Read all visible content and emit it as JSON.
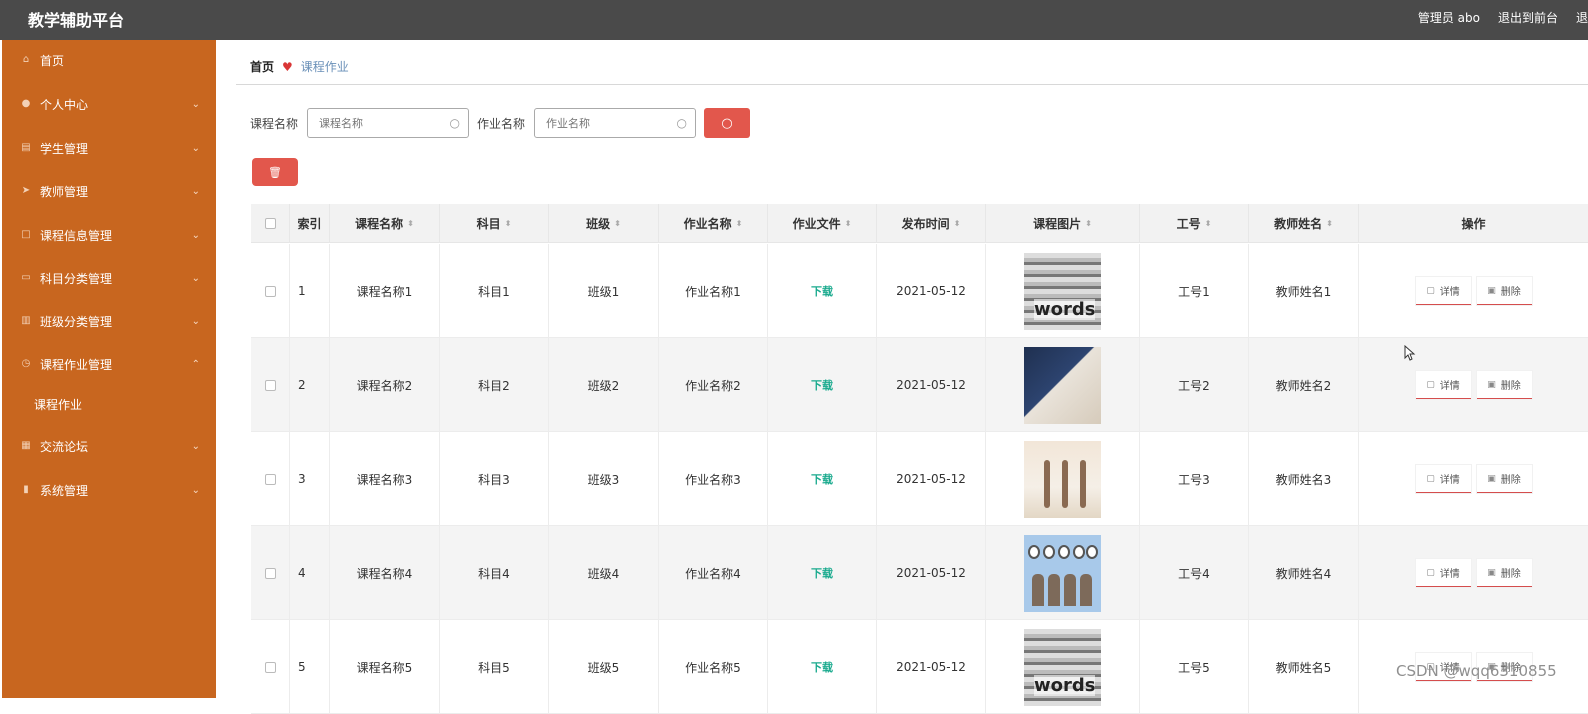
{
  "app": {
    "title": "教学辅助平台"
  },
  "topbar": {
    "user": "管理员 abo",
    "front_link": "退出到前台",
    "logout": "退"
  },
  "sidebar": {
    "items": [
      {
        "label": "首页",
        "icon": "home-icon"
      },
      {
        "label": "个人中心",
        "icon": "user-icon"
      },
      {
        "label": "学生管理",
        "icon": "list-icon"
      },
      {
        "label": "教师管理",
        "icon": "send-icon"
      },
      {
        "label": "课程信息管理",
        "icon": "square-icon"
      },
      {
        "label": "科目分类管理",
        "icon": "chat-icon"
      },
      {
        "label": "班级分类管理",
        "icon": "bar-chart-icon"
      },
      {
        "label": "课程作业管理",
        "icon": "clock-icon"
      },
      {
        "label": "交流论坛",
        "icon": "grid-icon"
      },
      {
        "label": "系统管理",
        "icon": "book-icon"
      }
    ],
    "sub_item": "课程作业"
  },
  "breadcrumb": {
    "home": "首页",
    "current": "课程作业"
  },
  "search": {
    "course_label": "课程名称",
    "course_placeholder": "课程名称",
    "homework_label": "作业名称",
    "homework_placeholder": "作业名称"
  },
  "table": {
    "headers": [
      "索引",
      "课程名称",
      "科目",
      "班级",
      "作业名称",
      "作业文件",
      "发布时间",
      "课程图片",
      "工号",
      "教师姓名",
      "操作"
    ],
    "rows": [
      {
        "index": "1",
        "course": "课程名称1",
        "subject": "科目1",
        "class": "班级1",
        "homework": "作业名称1",
        "file": "下载",
        "time": "2021-05-12",
        "image": "vocabulary-words",
        "job_no": "工号1",
        "teacher": "教师姓名1"
      },
      {
        "index": "2",
        "course": "课程名称2",
        "subject": "科目2",
        "class": "班级2",
        "homework": "作业名称2",
        "file": "下载",
        "time": "2021-05-12",
        "image": "suit-person",
        "job_no": "工号2",
        "teacher": "教师姓名2"
      },
      {
        "index": "3",
        "course": "课程名称3",
        "subject": "科目3",
        "class": "班级3",
        "homework": "作业名称3",
        "file": "下载",
        "time": "2021-05-12",
        "image": "dancers",
        "job_no": "工号3",
        "teacher": "教师姓名3"
      },
      {
        "index": "4",
        "course": "课程名称4",
        "subject": "科目4",
        "class": "班级4",
        "homework": "作业名称4",
        "file": "下载",
        "time": "2021-05-12",
        "image": "hello-kids",
        "job_no": "工号4",
        "teacher": "教师姓名4"
      },
      {
        "index": "5",
        "course": "课程名称5",
        "subject": "科目5",
        "class": "班级5",
        "homework": "作业名称5",
        "file": "下载",
        "time": "2021-05-12",
        "image": "vocabulary-words",
        "job_no": "工号5",
        "teacher": "教师姓名5"
      }
    ],
    "actions": {
      "detail": "详情",
      "delete": "删除"
    }
  },
  "watermark": "CSDN @wqq6310855",
  "colors": {
    "topbar": "#4a4a4a",
    "sidebar": "#c8661f",
    "accent": "#e2574c",
    "download": "#1aaa8e"
  }
}
